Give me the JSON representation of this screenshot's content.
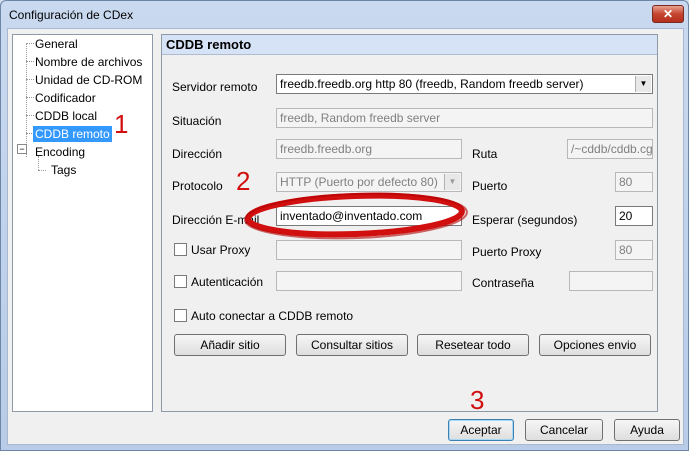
{
  "window": {
    "title": "Configuración de CDex",
    "close_glyph": "✕"
  },
  "tree": {
    "items": [
      {
        "label": "General"
      },
      {
        "label": "Nombre de archivos"
      },
      {
        "label": "Unidad de CD-ROM"
      },
      {
        "label": "Codificador"
      },
      {
        "label": "CDDB local"
      },
      {
        "label": "CDDB remoto",
        "selected": true
      },
      {
        "label": "Encoding",
        "expander": "−"
      },
      {
        "label": "Tags"
      }
    ]
  },
  "panel": {
    "header": "CDDB remoto",
    "servidor": {
      "label": "Servidor remoto",
      "value": "freedb.freedb.org http  80  (freedb, Random freedb server)"
    },
    "situacion": {
      "label": "Situación",
      "value": "freedb, Random freedb server"
    },
    "direccion": {
      "label": "Dirección",
      "value": "freedb.freedb.org"
    },
    "ruta": {
      "label": "Ruta",
      "value": "/~cddb/cddb.cgi"
    },
    "protocolo": {
      "label": "Protocolo",
      "value": "HTTP (Puerto por defecto 80)"
    },
    "puerto": {
      "label": "Puerto",
      "value": "80"
    },
    "email": {
      "label": "Dirección E-mail",
      "value": "inventado@inventado.com"
    },
    "esperar": {
      "label": "Esperar (segundos)",
      "value": "20"
    },
    "proxy": {
      "label": "Usar Proxy",
      "value": ""
    },
    "puerto_proxy": {
      "label": "Puerto Proxy",
      "value": "80"
    },
    "autenticacion": {
      "label": "Autenticación",
      "value": ""
    },
    "contrasena": {
      "label": "Contraseña",
      "value": ""
    },
    "auto_conectar": {
      "label": "Auto conectar a CDDB remoto"
    },
    "buttons": {
      "anadir": "Añadir sitio",
      "consultar": "Consultar sitios",
      "resetear": "Resetear todo",
      "opciones": "Opciones envio"
    }
  },
  "footer": {
    "aceptar": "Aceptar",
    "cancelar": "Cancelar",
    "ayuda": "Ayuda"
  },
  "annotations": {
    "n1": "1",
    "n2": "2",
    "n3": "3",
    "highlight_color": "#d10f0f"
  }
}
